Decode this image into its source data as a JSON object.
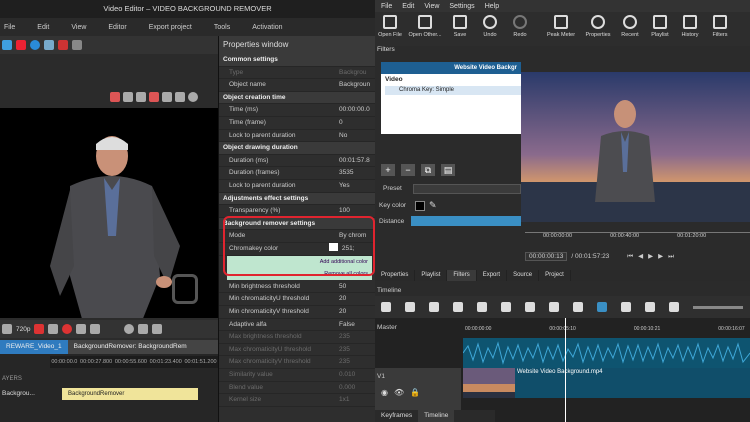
{
  "left_app": {
    "title": "Video Editor – VIDEO BACKGROUND REMOVER",
    "menu": [
      "File",
      "Edit",
      "View",
      "Editor",
      "Export project",
      "Tools",
      "Activation"
    ],
    "zoom": "720p",
    "tabs": [
      "REWARE_Video_1",
      "BackgroundRemover: BackgroundRem"
    ],
    "ruler": [
      "00:00:00.0",
      "00:00:27.800",
      "00:00:55.600",
      "00:01:23.400",
      "00:01:51.200"
    ],
    "layers_label": "AYERS",
    "track_label": "Backgrou...",
    "clip_label": "BackgroundRemover"
  },
  "properties": {
    "title": "Properties window",
    "rows": [
      {
        "k": "Common settings",
        "v": "",
        "t": "sec"
      },
      {
        "k": "Type",
        "v": "Backgrou",
        "t": "dim"
      },
      {
        "k": "Object name",
        "v": "Backgroun",
        "t": ""
      },
      {
        "k": "Object creation time",
        "v": "",
        "t": "sec"
      },
      {
        "k": "Time (ms)",
        "v": "00:00:00.0",
        "t": ""
      },
      {
        "k": "Time (frame)",
        "v": "0",
        "t": ""
      },
      {
        "k": "Lock to parent duration",
        "v": "No",
        "t": ""
      },
      {
        "k": "Object drawing duration",
        "v": "",
        "t": "sec"
      },
      {
        "k": "Duration (ms)",
        "v": "00:01:57.8",
        "t": ""
      },
      {
        "k": "Duration (frames)",
        "v": "3535",
        "t": ""
      },
      {
        "k": "Lock to parent duration",
        "v": "Yes",
        "t": ""
      },
      {
        "k": "Adjustments effect settings",
        "v": "",
        "t": "sec"
      },
      {
        "k": "Transparency (%)",
        "v": "100",
        "t": ""
      },
      {
        "k": "Background remover settings",
        "v": "",
        "t": "sec"
      },
      {
        "k": "Mode",
        "v": "By chrom",
        "t": ""
      },
      {
        "k": "Chromakey color",
        "v": "251;",
        "t": ""
      },
      {
        "k": "",
        "v": "",
        "t": "btn"
      },
      {
        "k": "",
        "v": "",
        "t": "btn"
      },
      {
        "k": "Min brightness threshold",
        "v": "50",
        "t": ""
      },
      {
        "k": "Min chromaticityU threshold",
        "v": "20",
        "t": ""
      },
      {
        "k": "Min chromaticityV threshold",
        "v": "20",
        "t": ""
      },
      {
        "k": "Adaptive alfa",
        "v": "False",
        "t": ""
      },
      {
        "k": "Max brightness threshold",
        "v": "235",
        "t": "dim"
      },
      {
        "k": "Max chromaticityU threshold",
        "v": "235",
        "t": "dim"
      },
      {
        "k": "Max chromaticityV threshold",
        "v": "235",
        "t": "dim"
      },
      {
        "k": "Similarity value",
        "v": "0.010",
        "t": "dim"
      },
      {
        "k": "Blend value",
        "v": "0.000",
        "t": "dim"
      },
      {
        "k": "Kernel size",
        "v": "1x1",
        "t": "dim"
      }
    ],
    "add_color": "Add additional color",
    "remove_colors": "Remove all colors"
  },
  "right_app": {
    "menu": [
      "File",
      "Edit",
      "View",
      "Settings",
      "Help"
    ],
    "toolbar": [
      "Open File",
      "Open Other...",
      "Save",
      "Undo",
      "Redo",
      "Peak Meter",
      "Properties",
      "Recent",
      "Playlist",
      "History",
      "Filters"
    ],
    "filters_label": "Filters",
    "filter_header": "Website Video Backgr",
    "filter_video": "Video",
    "filter_item": "Chroma Key: Simple",
    "preset": "Preset",
    "key_color": "Key color",
    "distance": "Distance",
    "ruler": [
      "00:00:00:00",
      "00:00:40:00",
      "00:01:20:00"
    ],
    "timecode_current": "00:00:00:13",
    "timecode_total": "/ 00:01:57:23",
    "tabs": [
      "Properties",
      "Playlist",
      "Filters",
      "Export",
      "Source",
      "Project"
    ],
    "timeline_label": "Timeline",
    "timeline_ruler": [
      "00:00:00:00",
      "00:00:05:10",
      "00:00:10:21",
      "00:00:16:07"
    ],
    "master": "Master",
    "v1": "V1",
    "clip_label": "Website Video Background.mp4",
    "bottom_tabs": [
      "Keyframes",
      "Timeline"
    ]
  }
}
